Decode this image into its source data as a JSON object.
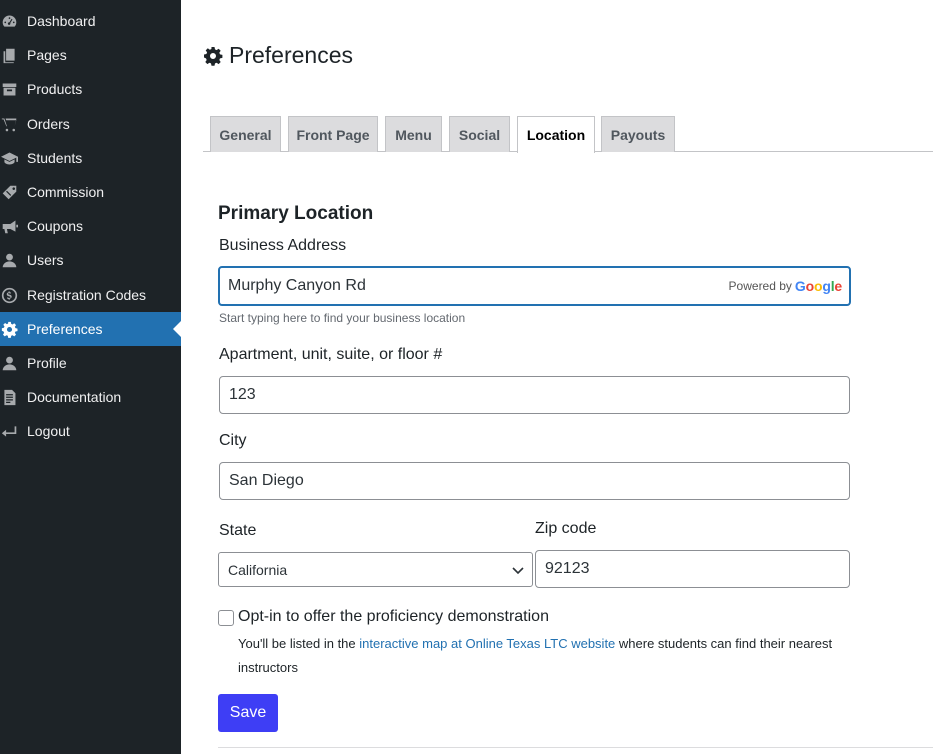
{
  "sidebar": {
    "items": [
      {
        "label": "Dashboard",
        "icon": "dashboard-icon"
      },
      {
        "label": "Pages",
        "icon": "pages-icon"
      },
      {
        "label": "Products",
        "icon": "archive-icon"
      },
      {
        "label": "Orders",
        "icon": "cart-icon"
      },
      {
        "label": "Students",
        "icon": "graduation-cap-icon"
      },
      {
        "label": "Commission",
        "icon": "tag-icon"
      },
      {
        "label": "Coupons",
        "icon": "megaphone-icon"
      },
      {
        "label": "Users",
        "icon": "user-icon"
      },
      {
        "label": "Registration Codes",
        "icon": "dollar-circle-icon"
      },
      {
        "label": "Preferences",
        "icon": "gear-icon",
        "active": true
      },
      {
        "label": "Profile",
        "icon": "user-icon"
      },
      {
        "label": "Documentation",
        "icon": "document-icon"
      },
      {
        "label": "Logout",
        "icon": "logout-icon"
      }
    ]
  },
  "header": {
    "title": "Preferences"
  },
  "tabs": [
    {
      "label": "General"
    },
    {
      "label": "Front Page"
    },
    {
      "label": "Menu"
    },
    {
      "label": "Social"
    },
    {
      "label": "Location",
      "active": true
    },
    {
      "label": "Payouts"
    }
  ],
  "form": {
    "section_title": "Primary Location",
    "address": {
      "label": "Business Address",
      "value": "Murphy Canyon Rd",
      "powered_by": "Powered by",
      "google": "Google",
      "help": "Start typing here to find your business location"
    },
    "unit": {
      "label": "Apartment, unit, suite, or floor #",
      "value": "123"
    },
    "city": {
      "label": "City",
      "value": "San Diego"
    },
    "state": {
      "label": "State",
      "value": "California"
    },
    "zip": {
      "label": "Zip code",
      "value": "92123"
    },
    "optin": {
      "label": "Opt-in to offer the proficiency demonstration",
      "checked": false,
      "note_before": "You'll be listed in the ",
      "note_link": "interactive map at Online Texas LTC website",
      "note_after": " where students can find their nearest instructors"
    },
    "save_label": "Save"
  },
  "colors": {
    "sidebar_bg": "#1d2327",
    "active_bg": "#2271b1",
    "save_bg": "#3e3ef5",
    "link": "#2271b1"
  }
}
